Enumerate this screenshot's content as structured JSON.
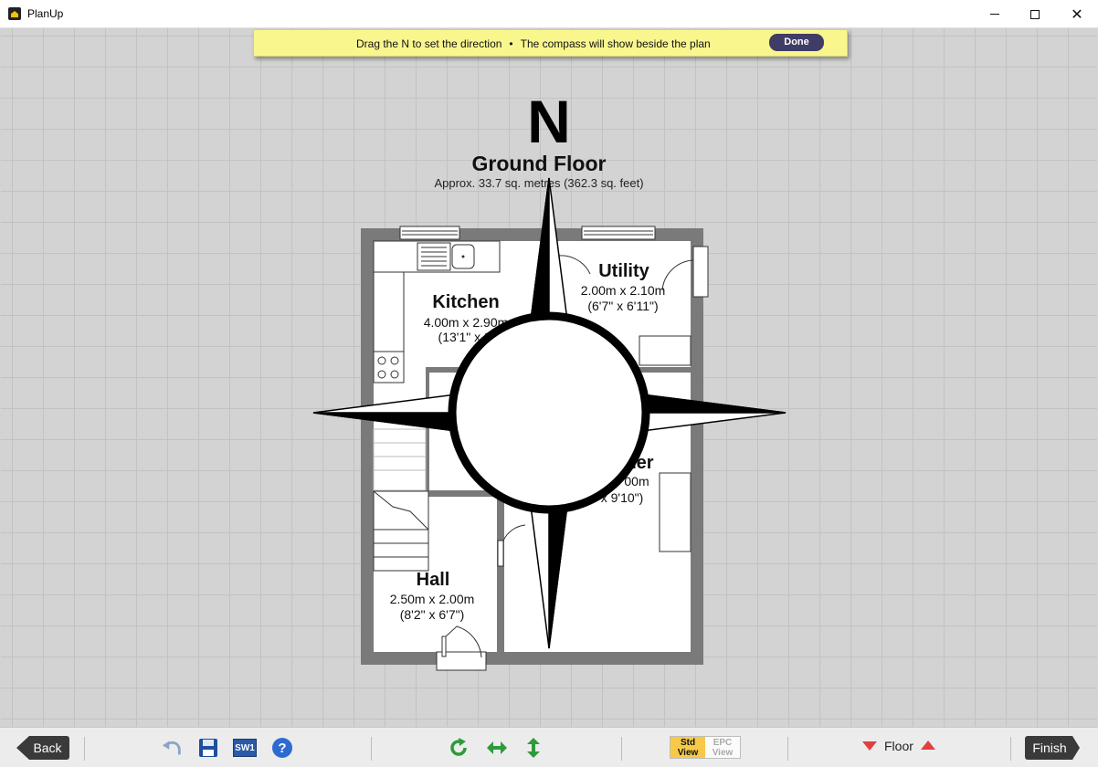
{
  "window": {
    "title": "PlanUp"
  },
  "hint": {
    "text_1": "Drag the N to set the direction",
    "text_2": "The compass will show beside the plan",
    "done_label": "Done"
  },
  "compass": {
    "north_label": "N"
  },
  "plan": {
    "floor_title": "Ground Floor",
    "floor_area": "Approx. 33.7 sq. metres (362.3 sq. feet)",
    "rooms": [
      {
        "name": "Kitchen",
        "dim_m": "4.00m x 2.90m",
        "dim_ft": "(13'1\" x 9'"
      },
      {
        "name": "Utility",
        "dim_m": "2.00m x 2.10m",
        "dim_ft": "(6'7\" x 6'11\")"
      },
      {
        "name": "Hall",
        "dim_m": "2.50m x 2.00m",
        "dim_ft": "(8'2\" x 6'7\")"
      },
      {
        "name": "ner",
        "dim_m": "00m",
        "dim_ft": "x 9'10\")"
      }
    ]
  },
  "toolbar": {
    "back_label": "Back",
    "sw1_label": "SW1",
    "help_label": "?",
    "std_view_label_1": "Std",
    "std_view_label_2": "View",
    "epc_view_label_1": "EPC",
    "epc_view_label_2": "View",
    "floor_label": "Floor",
    "finish_label": "Finish"
  },
  "colors": {
    "hint_bg": "#f9f68e",
    "done_bg": "#3f3c66",
    "wall": "#7a7a7a",
    "std_view_bg": "#f7c948",
    "arrow_red": "#e04040",
    "rotate_green": "#2f9a3a"
  }
}
